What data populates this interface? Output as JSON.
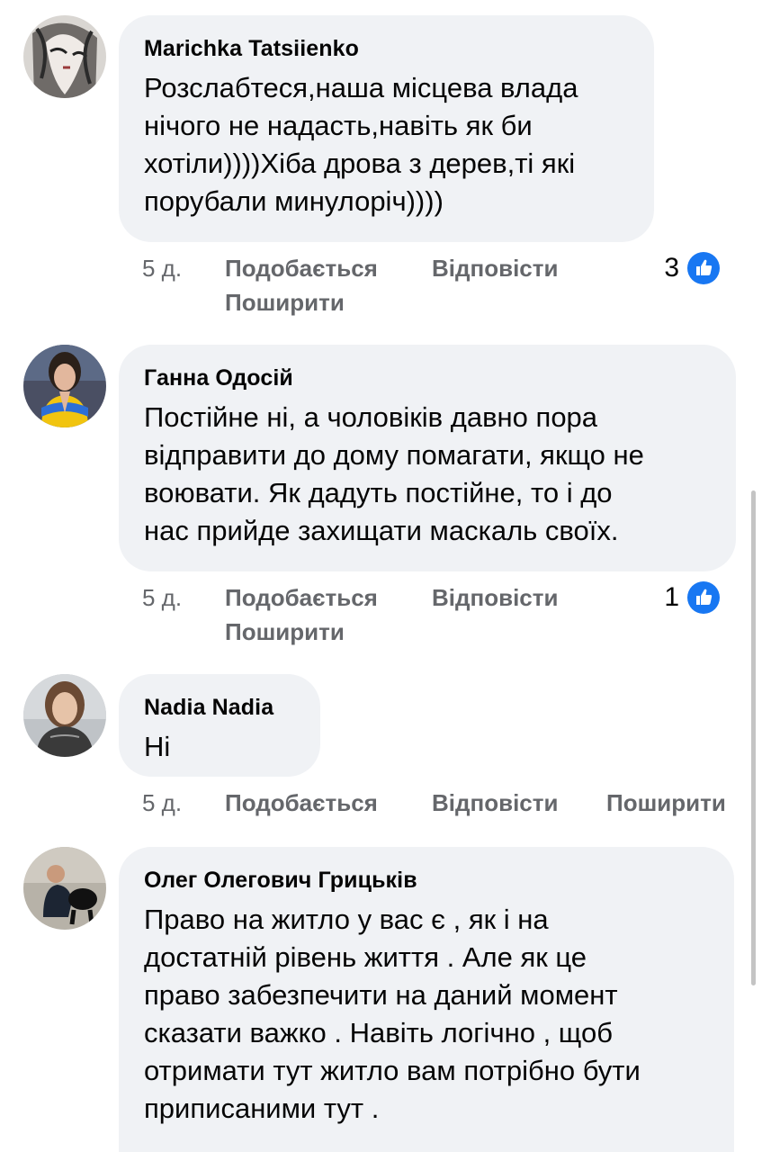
{
  "comments": [
    {
      "author": "Marichka Tatsiienko",
      "text": "Розслабтеся,наша місцева влада\nнічого не надасть,навіть як би\nхотіли))))Хіба дрова з дерев,ті які\nпорубали минулоріч))))",
      "time": "5 д.",
      "like_label": "Подобається",
      "reply_label": "Відповісти",
      "share_label": "Поширити",
      "reaction_count": "3"
    },
    {
      "author": "Ганна Одосій",
      "text": "Постійне ні, а чоловіків давно пора\nвідправити до дому помагати, якщо не\nвоювати. Як дадуть постійне, то і до\nнас прийде захищати маскаль своїх.",
      "time": "5 д.",
      "like_label": "Подобається",
      "reply_label": "Відповісти",
      "share_label": "Поширити",
      "reaction_count": "1"
    },
    {
      "author": "Nadia Nadia",
      "text": "Ні",
      "time": "5 д.",
      "like_label": "Подобається",
      "reply_label": "Відповісти",
      "share_label": "Поширити"
    },
    {
      "author": "Олег Олегович Грицьків",
      "text": "Право на житло у вас є , як і на\nдостатній рівень життя . Але як це\nправо забезпечити на даний момент\nсказати важко . Навіть логічно , щоб\nотримати тут житло вам потрібно бути\nприписаними тут ."
    }
  ],
  "icons": {
    "like": "like-thumb-icon"
  },
  "colors": {
    "bubble": "#f0f2f5",
    "like_blue": "#1877f2",
    "meta_text": "#65676b"
  }
}
